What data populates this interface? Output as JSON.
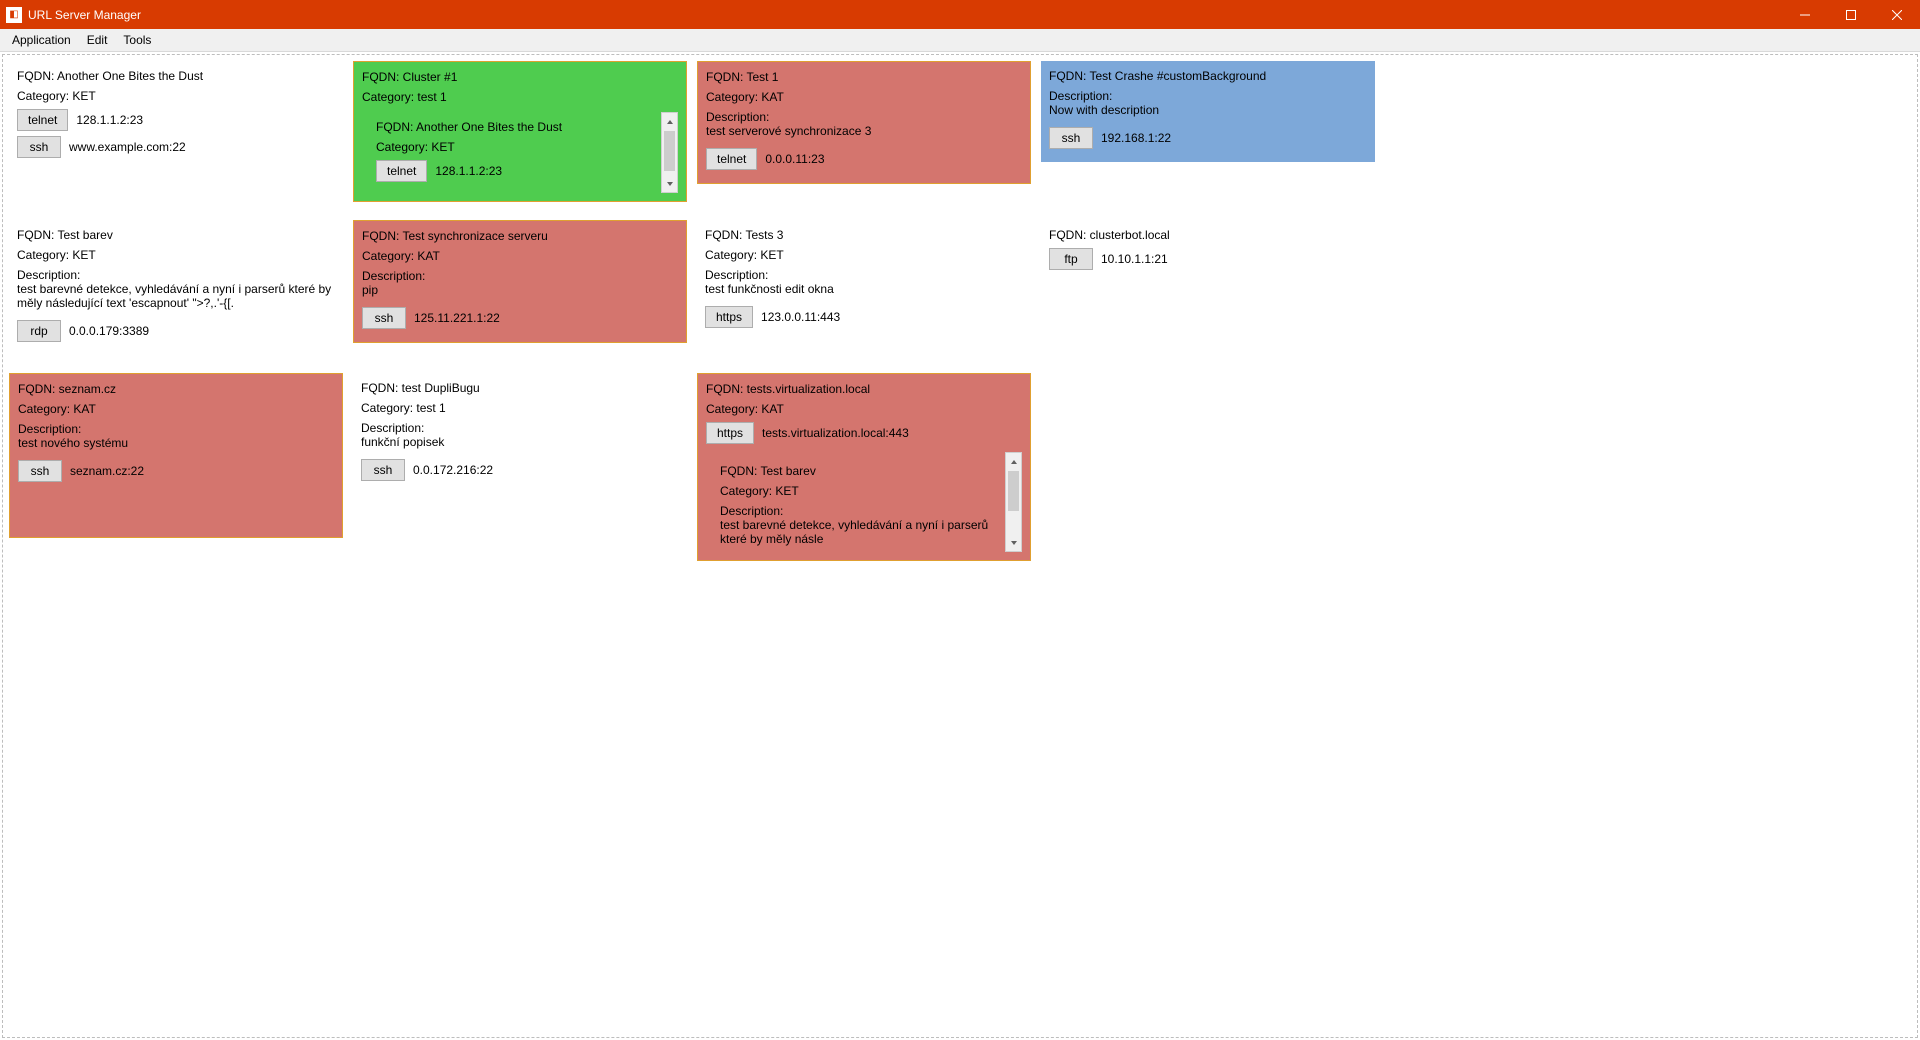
{
  "window": {
    "title": "URL Server Manager"
  },
  "menu": {
    "application": "Application",
    "edit": "Edit",
    "tools": "Tools"
  },
  "labels": {
    "fqdn_prefix": "FQDN: ",
    "category_prefix": "Category: ",
    "description_label": "Description:"
  },
  "cards": {
    "c1": {
      "fqdn": "Another One Bites the Dust",
      "category": "KET",
      "protos": [
        {
          "btn": "telnet",
          "addr": "128.1.1.2:23"
        },
        {
          "btn": "ssh",
          "addr": "www.example.com:22"
        }
      ]
    },
    "c2": {
      "fqdn": "Cluster #1",
      "category": "test 1",
      "nested": {
        "fqdn": "Another One Bites the Dust",
        "category": "KET",
        "proto": {
          "btn": "telnet",
          "addr": "128.1.1.2:23"
        }
      }
    },
    "c3": {
      "fqdn": "Test 1",
      "category": "KAT",
      "description": "test serverové synchronizace 3",
      "proto": {
        "btn": "telnet",
        "addr": "0.0.0.11:23"
      }
    },
    "c4": {
      "fqdn": "Test Crashe #customBackground",
      "description": "Now with description",
      "proto": {
        "btn": "ssh",
        "addr": "192.168.1:22"
      }
    },
    "c5": {
      "fqdn": "Test barev",
      "category": "KET",
      "description": "test barevné detekce, vyhledávání a nyní i parserů které by měly následující text 'escapnout' \">?,.'-{[.",
      "proto": {
        "btn": "rdp",
        "addr": "0.0.0.179:3389"
      }
    },
    "c6": {
      "fqdn": "Test synchronizace serveru",
      "category": "KAT",
      "description": "pip",
      "proto": {
        "btn": "ssh",
        "addr": "125.11.221.1:22"
      }
    },
    "c7": {
      "fqdn": "Tests 3",
      "category": "KET",
      "description": "test funkčnosti edit okna",
      "proto": {
        "btn": "https",
        "addr": "123.0.0.11:443"
      }
    },
    "c8": {
      "fqdn": "clusterbot.local",
      "proto": {
        "btn": "ftp",
        "addr": "10.10.1.1:21"
      }
    },
    "c9": {
      "fqdn": "seznam.cz",
      "category": "KAT",
      "description": "test nového systému",
      "proto": {
        "btn": "ssh",
        "addr": "seznam.cz:22"
      }
    },
    "c10": {
      "fqdn": "test DupliBugu",
      "category": "test 1",
      "description": "funkční popisek",
      "proto": {
        "btn": "ssh",
        "addr": "0.0.172.216:22"
      }
    },
    "c11": {
      "fqdn": "tests.virtualization.local",
      "category": "KAT",
      "proto": {
        "btn": "https",
        "addr": "tests.virtualization.local:443"
      },
      "nested": {
        "fqdn": "Test barev",
        "category": "KET",
        "description": "test barevné detekce, vyhledávání a nyní i parserů které by měly násle"
      }
    }
  }
}
